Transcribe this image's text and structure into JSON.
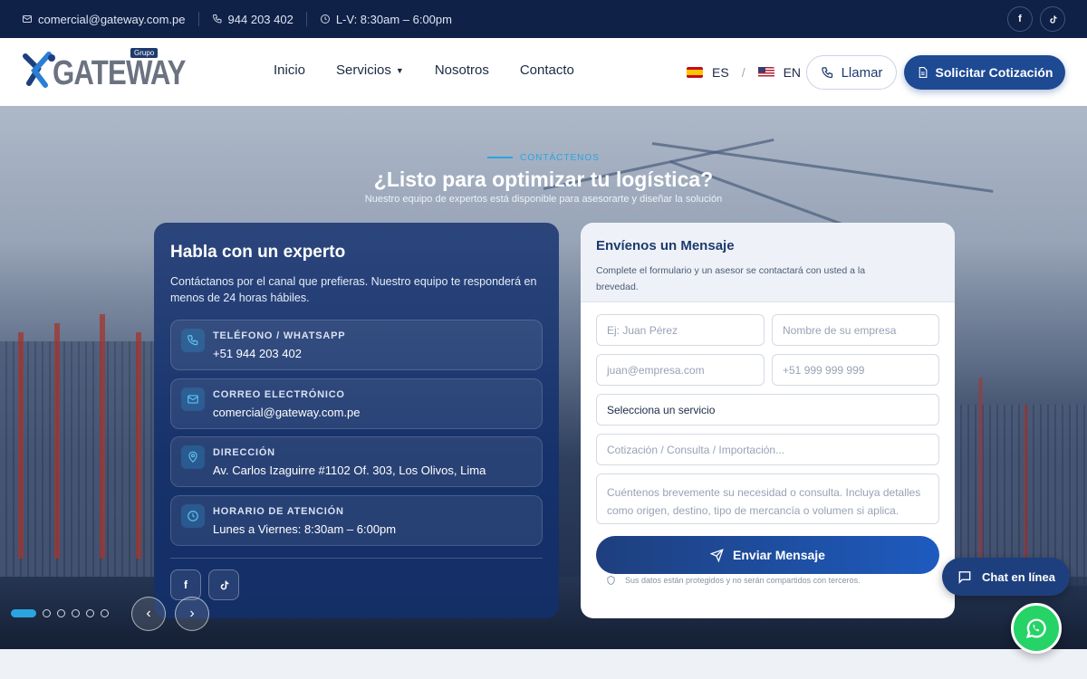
{
  "topbar": {
    "email": "comercial@gateway.com.pe",
    "phone": "944 203 402",
    "hours": "L-V: 8:30am – 6:00pm",
    "social": [
      "f",
      "tiktok"
    ]
  },
  "header": {
    "logo_word": "GATEWAY",
    "logo_badge": "Grupo",
    "nav": [
      "Inicio",
      "Servicios",
      "Nosotros",
      "Contacto"
    ],
    "lang_es": "ES",
    "lang_sep": "/",
    "lang_en": "EN",
    "call_label": "Llamar",
    "quote_label": "Solicitar Cotización"
  },
  "hero": {
    "eyebrow": "CONTÁCTENOS",
    "title": "¿Listo para optimizar tu logística?",
    "subtitle": "Nuestro equipo de expertos está disponible para asesorarte y diseñar la solución"
  },
  "left_card": {
    "title": "Habla con un experto",
    "text": "Contáctanos por el canal que prefieras. Nuestro equipo te responderá en menos de 24 horas hábiles.",
    "items": [
      {
        "label": "TELÉFONO / WHATSAPP",
        "value": "+51 944 203 402",
        "icon": "phone-icon"
      },
      {
        "label": "CORREO ELECTRÓNICO",
        "value": "comercial@gateway.com.pe",
        "icon": "mail-icon"
      },
      {
        "label": "DIRECCIÓN",
        "value": "Av. Carlos Izaguirre #1102 Of. 303, Los Olivos, Lima",
        "icon": "location-pin-icon"
      },
      {
        "label": "HORARIO DE ATENCIÓN",
        "value": "Lunes a Viernes: 8:30am – 6:00pm",
        "icon": "clock-icon"
      }
    ]
  },
  "form": {
    "title": "Envíenos un Mensaje",
    "description": "Complete el formulario y un asesor se contactará con usted a la brevedad.",
    "name_placeholder": "Ej: Juan Pérez",
    "company_placeholder": "Nombre de su empresa",
    "email_placeholder": "juan@empresa.com",
    "phone_placeholder": "+51 999 999 999",
    "service_selected": "Selecciona un servicio",
    "subject_placeholder": "Cotización / Consulta / Importación...",
    "message_placeholder": "Cuéntenos brevemente su necesidad o consulta. Incluya detalles como origen, destino, tipo de mercancía o volumen si aplica.",
    "send_label": "Enviar Mensaje",
    "privacy": "Sus datos están protegidos y no serán compartidos con terceros."
  },
  "slider": {
    "dots": 6,
    "active": 0
  },
  "chat": {
    "label": "Chat en línea"
  },
  "colors": {
    "navy": "#0f2147",
    "primary": "#1e4a93",
    "accent": "#2aa5e0",
    "whatsapp": "#25d366"
  }
}
